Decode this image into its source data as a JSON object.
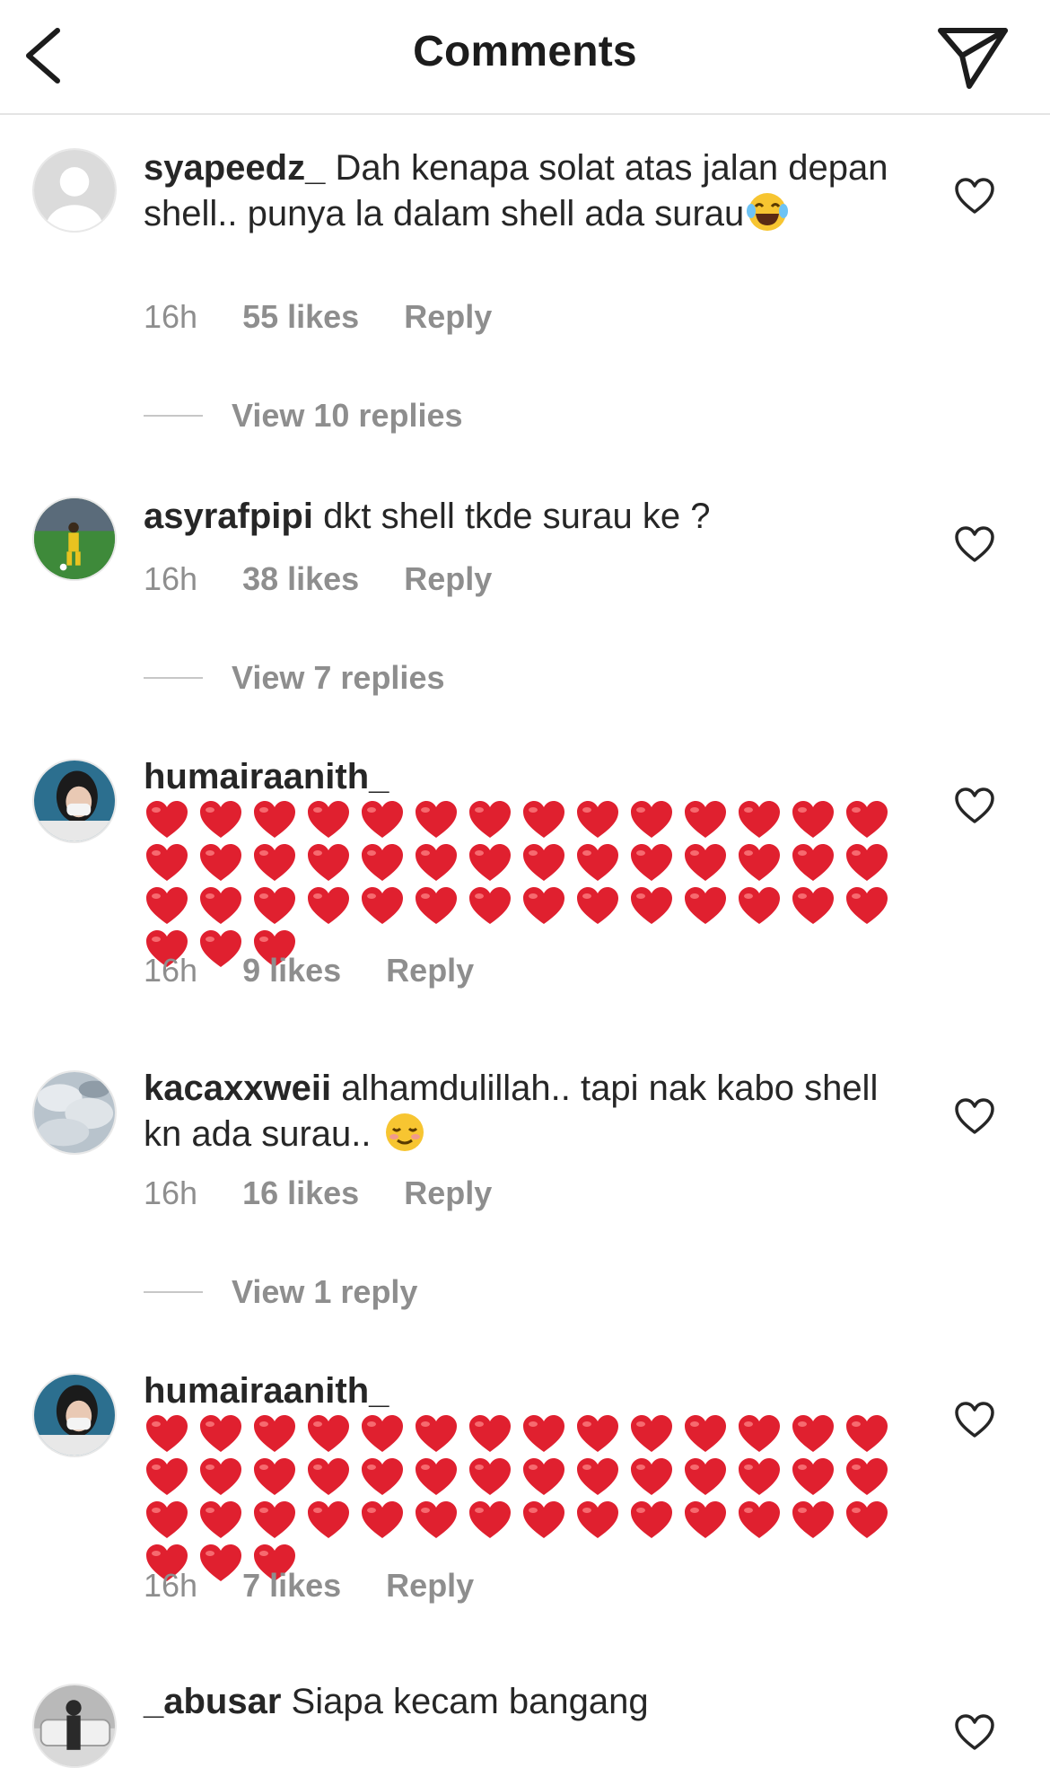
{
  "header": {
    "title": "Comments"
  },
  "comments": [
    {
      "username": "syapeedz_",
      "text": "Dah kenapa solat atas jalan depan shell.. punya la dalam shell ada surau",
      "emoji": "laughing-tears",
      "time": "16h",
      "likes": "55 likes",
      "reply": "Reply",
      "view_replies": "View 10 replies"
    },
    {
      "username": "asyrafpipi",
      "text": "dkt shell tkde surau ke ?",
      "time": "16h",
      "likes": "38 likes",
      "reply": "Reply",
      "view_replies": "View 7 replies"
    },
    {
      "username": "humairaanith_",
      "text": "",
      "heart_count": 45,
      "time": "16h",
      "likes": "9 likes",
      "reply": "Reply"
    },
    {
      "username": "kacaxxweii",
      "text": "alhamdulillah.. tapi nak kabo shell kn ada surau..",
      "emoji": "smiling-blush",
      "time": "16h",
      "likes": "16 likes",
      "reply": "Reply",
      "view_replies": "View 1 reply"
    },
    {
      "username": "humairaanith_",
      "text": "",
      "heart_count": 45,
      "time": "16h",
      "likes": "7 likes",
      "reply": "Reply"
    },
    {
      "username": "_abusar",
      "text": "Siapa kecam bangang"
    }
  ],
  "colors": {
    "heart_red": "#e0202f",
    "meta_grey": "#8e8e8e",
    "text": "#262626"
  }
}
